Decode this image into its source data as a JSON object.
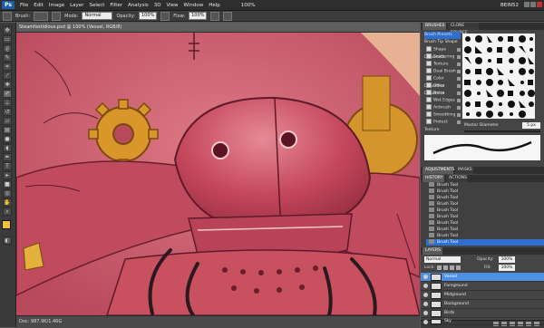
{
  "menubar": {
    "logo": "Ps",
    "items": [
      "File",
      "Edit",
      "Image",
      "Layer",
      "Select",
      "Filter",
      "Analysis",
      "3D",
      "View",
      "Window",
      "Help"
    ],
    "zoom": "100%",
    "workspace": "BEIN52"
  },
  "options": {
    "brush_label": "Brush:",
    "mode_label": "Mode:",
    "mode_value": "Normal",
    "opacity_label": "Opacity:",
    "opacity_value": "100%",
    "flow_label": "Flow:",
    "flow_value": "100%"
  },
  "document": {
    "tab_title": "Steamfastidious.psd @ 100% (Vessel, RGB/8)",
    "status": "Doc: 987.9K/1.46G"
  },
  "brushes_panel": {
    "tabs": [
      "BRUSHES",
      "CLONE SOURCE"
    ],
    "options": [
      "Brush Presets",
      "Brush Tip Shape",
      "Shape Dynamics",
      "Scattering",
      "Texture",
      "Dual Brush",
      "Color Dynamics",
      "Other Dynamics",
      "Noise",
      "Wet Edges",
      "Airbrush",
      "Smoothing",
      "Protect Texture"
    ],
    "master_diameter_label": "Master Diameter",
    "master_diameter_value": "5 px"
  },
  "adjust_tabs": [
    "ADJUSTMENTS",
    "MASKS"
  ],
  "history_panel": {
    "tabs": [
      "HISTORY",
      "ACTIONS"
    ],
    "items": [
      "Brush Tool",
      "Brush Tool",
      "Brush Tool",
      "Brush Tool",
      "Brush Tool",
      "Brush Tool",
      "Brush Tool",
      "Brush Tool",
      "Brush Tool",
      "Brush Tool"
    ]
  },
  "layers_panel": {
    "title": "LAYERS",
    "blend_mode": "Normal",
    "opacity_label": "Opacity:",
    "opacity_value": "100%",
    "lock_label": "Lock:",
    "fill_label": "Fill:",
    "fill_value": "100%",
    "layers": [
      "Vessel",
      "Foreground",
      "Midground",
      "Background",
      "Birds",
      "Sky"
    ]
  },
  "colors": {
    "canvas_bg": "#d2586a",
    "robot_head": "#c4445a",
    "gear": "#d9962a",
    "accent_selection": "#2e6fd0"
  }
}
